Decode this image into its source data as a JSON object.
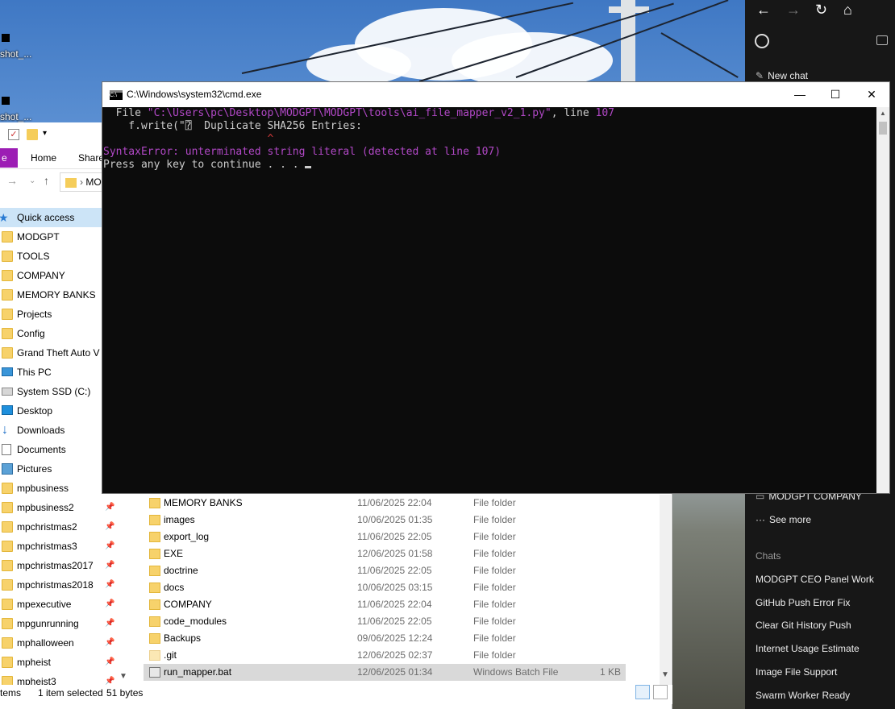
{
  "desktop": {
    "icons": [
      {
        "label": "shot_..."
      },
      {
        "label": "shot_..."
      }
    ]
  },
  "cmd": {
    "title": "C:\\Windows\\system32\\cmd.exe",
    "minimize_label": "—",
    "maximize_label": "☐",
    "close_label": "✕",
    "lines": {
      "l1_a": "  File ",
      "l1_path": "\"C:\\Users\\pc\\Desktop\\MODGPT\\MODGPT\\tools\\ai_file_mapper_v2_1.py\"",
      "l1_b": ", line ",
      "l1_num": "107",
      "l2": "    f.write(\"⍰  Duplicate SHA256 Entries:",
      "l3": "                          ^",
      "l4_a": "SyntaxError",
      "l4_b": ": unterminated string literal (detected at line 107)",
      "l5": "Press any key to continue . . . "
    }
  },
  "explorer": {
    "ribbon": {
      "file": "e",
      "home": "Home",
      "share": "Share"
    },
    "address": "MO",
    "nav_items": [
      {
        "label": "Quick access",
        "icon": "star-icon",
        "pinned": false,
        "selected": true
      },
      {
        "label": "MODGPT",
        "icon": "folder-icon",
        "pinned": false
      },
      {
        "label": "TOOLS",
        "icon": "folder-icon",
        "pinned": false
      },
      {
        "label": "COMPANY",
        "icon": "folder-icon",
        "pinned": false
      },
      {
        "label": "MEMORY BANKS",
        "icon": "folder-icon",
        "pinned": false
      },
      {
        "label": "Projects",
        "icon": "folder-icon",
        "pinned": false
      },
      {
        "label": "Config",
        "icon": "folder-icon",
        "pinned": false
      },
      {
        "label": "Grand Theft Auto V L",
        "icon": "folder-icon",
        "pinned": false
      },
      {
        "label": "This PC",
        "icon": "pc-icon",
        "pinned": false
      },
      {
        "label": "System SSD (C:)",
        "icon": "drive-icon",
        "pinned": false
      },
      {
        "label": "Desktop",
        "icon": "desktop-icon",
        "pinned": false
      },
      {
        "label": "Downloads",
        "icon": "downloads-icon",
        "pinned": false
      },
      {
        "label": "Documents",
        "icon": "documents-icon",
        "pinned": false
      },
      {
        "label": "Pictures",
        "icon": "pictures-icon",
        "pinned": false
      },
      {
        "label": "mpbusiness",
        "icon": "folder-icon",
        "pinned": false
      },
      {
        "label": "mpbusiness2",
        "icon": "folder-icon",
        "pinned": true
      },
      {
        "label": "mpchristmas2",
        "icon": "folder-icon",
        "pinned": true
      },
      {
        "label": "mpchristmas3",
        "icon": "folder-icon",
        "pinned": true
      },
      {
        "label": "mpchristmas2017",
        "icon": "folder-icon",
        "pinned": true
      },
      {
        "label": "mpchristmas2018",
        "icon": "folder-icon",
        "pinned": true
      },
      {
        "label": "mpexecutive",
        "icon": "folder-icon",
        "pinned": true
      },
      {
        "label": "mpgunrunning",
        "icon": "folder-icon",
        "pinned": true
      },
      {
        "label": "mphalloween",
        "icon": "folder-icon",
        "pinned": true
      },
      {
        "label": "mpheist",
        "icon": "folder-icon",
        "pinned": true
      },
      {
        "label": "mpheist3",
        "icon": "folder-icon",
        "pinned": true
      }
    ],
    "files": [
      {
        "name": "MEMORY BANKS",
        "date": "11/06/2025 22:04",
        "type": "File folder",
        "size": "",
        "kind": "folder"
      },
      {
        "name": "images",
        "date": "10/06/2025 01:35",
        "type": "File folder",
        "size": "",
        "kind": "folder"
      },
      {
        "name": "export_log",
        "date": "11/06/2025 22:05",
        "type": "File folder",
        "size": "",
        "kind": "folder"
      },
      {
        "name": "EXE",
        "date": "12/06/2025 01:58",
        "type": "File folder",
        "size": "",
        "kind": "folder"
      },
      {
        "name": "doctrine",
        "date": "11/06/2025 22:05",
        "type": "File folder",
        "size": "",
        "kind": "folder"
      },
      {
        "name": "docs",
        "date": "10/06/2025 03:15",
        "type": "File folder",
        "size": "",
        "kind": "folder"
      },
      {
        "name": "COMPANY",
        "date": "11/06/2025 22:04",
        "type": "File folder",
        "size": "",
        "kind": "folder"
      },
      {
        "name": "code_modules",
        "date": "11/06/2025 22:05",
        "type": "File folder",
        "size": "",
        "kind": "folder"
      },
      {
        "name": "Backups",
        "date": "09/06/2025 12:24",
        "type": "File folder",
        "size": "",
        "kind": "folder"
      },
      {
        "name": ".git",
        "date": "12/06/2025 02:37",
        "type": "File folder",
        "size": "",
        "kind": "git"
      },
      {
        "name": "run_mapper.bat",
        "date": "12/06/2025 01:34",
        "type": "Windows Batch File",
        "size": "1 KB",
        "kind": "bat",
        "selected": true
      }
    ],
    "status": {
      "items": "tems",
      "selected": "1 item selected",
      "bytes": "51 bytes"
    }
  },
  "chatgpt": {
    "new_chat": "New chat",
    "project": "MODGPT COMPANY",
    "see_more": "See more",
    "chats_header": "Chats",
    "chats": [
      "MODGPT CEO Panel Work",
      "GitHub Push Error Fix",
      "Clear Git History Push",
      "Internet Usage Estimate",
      "Image File Support",
      "Swarm Worker Ready"
    ]
  }
}
